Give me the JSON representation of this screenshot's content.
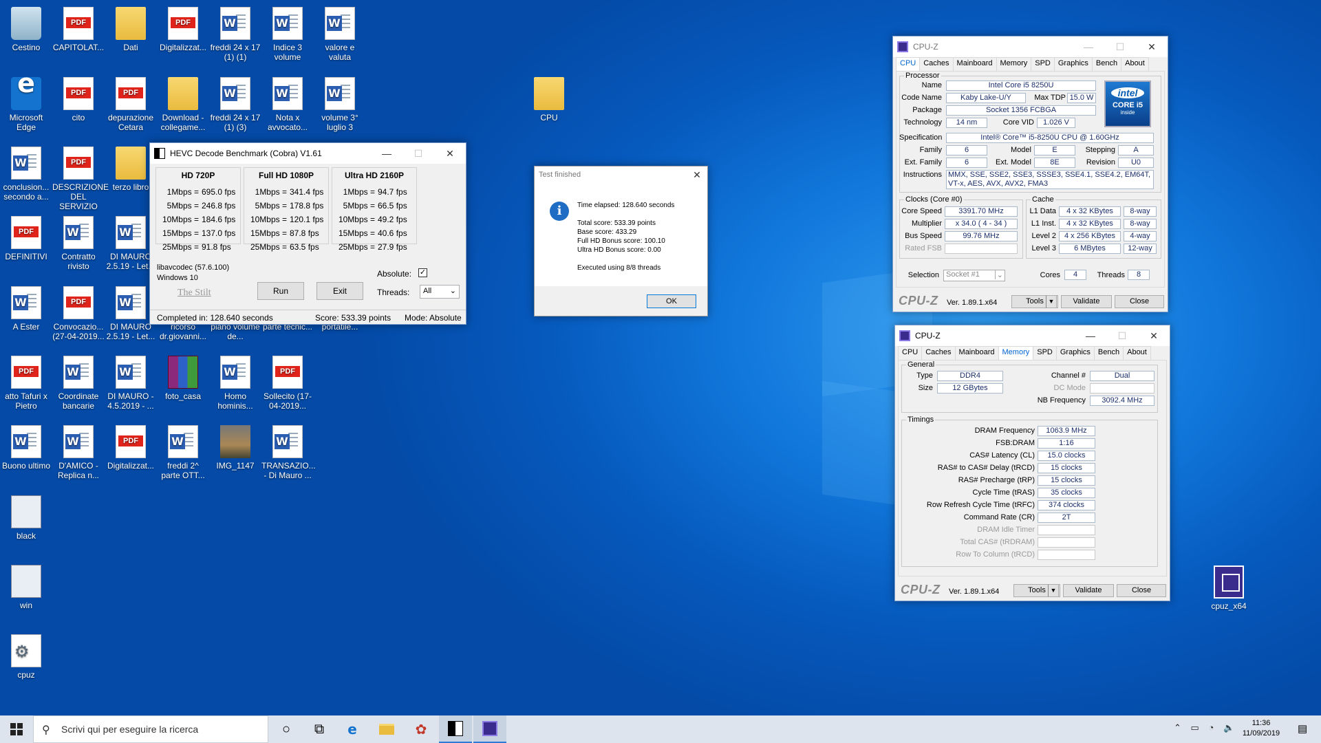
{
  "desktop_icons": [
    {
      "label": "Cestino",
      "type": "bin"
    },
    {
      "label": "CAPITOLAT...",
      "type": "pdf"
    },
    {
      "label": "Dati",
      "type": "folder"
    },
    {
      "label": "Digitalizzat...",
      "type": "pdf"
    },
    {
      "label": "freddi 24 x 17 (1) (1)",
      "type": "doc"
    },
    {
      "label": "Indice 3 volume",
      "type": "doc"
    },
    {
      "label": "valore e valuta",
      "type": "doc"
    },
    {
      "label": "Microsoft Edge",
      "type": "edge"
    },
    {
      "label": "cito",
      "type": "pdf"
    },
    {
      "label": "depurazione Cetara",
      "type": "pdf"
    },
    {
      "label": "Download - collegame...",
      "type": "folder"
    },
    {
      "label": "freddi 24 x 17 (1) (3)",
      "type": "doc"
    },
    {
      "label": "Nota x avvocato...",
      "type": "doc"
    },
    {
      "label": "volume 3° luglio 3",
      "type": "doc"
    },
    {
      "label": "conclusion... secondo a...",
      "type": "doc"
    },
    {
      "label": "DESCRIZIONE DEL SERVIZIO",
      "type": "pdf"
    },
    {
      "label": "terzo libro",
      "type": "folder"
    },
    {
      "label": "DEFINITIVI",
      "type": "pdf"
    },
    {
      "label": "Contratto rivisto",
      "type": "doc"
    },
    {
      "label": "DI MAURO 2.5.19 - Let...",
      "type": "doc"
    },
    {
      "label": "A Ester",
      "type": "doc"
    },
    {
      "label": "Convocazio... (27-04-2019...",
      "type": "pdf"
    },
    {
      "label": "DI MAURO 2.5.19 - Let...",
      "type": "doc"
    },
    {
      "label": "ricorso dr.giovanni...",
      "type": "doc"
    },
    {
      "label": "piano volume de...",
      "type": "doc"
    },
    {
      "label": "parte tecnic...",
      "type": "doc"
    },
    {
      "label": "portatile...",
      "type": "doc"
    },
    {
      "label": "atto Tafuri x Pietro",
      "type": "pdf"
    },
    {
      "label": "Coordinate bancarie",
      "type": "doc"
    },
    {
      "label": "DI MAURO - 4.5.2019 - ...",
      "type": "doc"
    },
    {
      "label": "foto_casa",
      "type": "rar"
    },
    {
      "label": "Homo hominis...",
      "type": "doc"
    },
    {
      "label": "Sollecito (17-04-2019...",
      "type": "pdf"
    },
    {
      "label": "Buono ultimo",
      "type": "doc"
    },
    {
      "label": "D'AMICO - Replica n...",
      "type": "doc"
    },
    {
      "label": "Digitalizzat...",
      "type": "pdf"
    },
    {
      "label": "freddi 2^ parte OTT...",
      "type": "doc"
    },
    {
      "label": "IMG_1147",
      "type": "photo"
    },
    {
      "label": "TRANSAZIO... - Di Mauro ...",
      "type": "doc"
    },
    {
      "label": "black",
      "type": "exe"
    },
    {
      "label": "win",
      "type": "exe"
    },
    {
      "label": "cpuz",
      "type": "gear"
    },
    {
      "label": "CPU",
      "type": "folder"
    },
    {
      "label": "cpuz_x64",
      "type": "cpuz"
    }
  ],
  "hevc": {
    "title": "HEVC Decode Benchmark (Cobra) V1.61",
    "columns": [
      {
        "heading": "HD 720P",
        "rows": [
          [
            "1Mbps =",
            "695.0 fps"
          ],
          [
            "5Mbps =",
            "246.8 fps"
          ],
          [
            "10Mbps =",
            "184.6 fps"
          ],
          [
            "15Mbps =",
            "137.0 fps"
          ],
          [
            "25Mbps =",
            "91.8 fps"
          ]
        ]
      },
      {
        "heading": "Full HD 1080P",
        "rows": [
          [
            "1Mbps =",
            "341.4 fps"
          ],
          [
            "5Mbps =",
            "178.8 fps"
          ],
          [
            "10Mbps =",
            "120.1 fps"
          ],
          [
            "15Mbps =",
            "87.8 fps"
          ],
          [
            "25Mbps =",
            "63.5 fps"
          ]
        ]
      },
      {
        "heading": "Ultra HD 2160P",
        "rows": [
          [
            "1Mbps =",
            "94.7 fps"
          ],
          [
            "5Mbps =",
            "66.5 fps"
          ],
          [
            "10Mbps =",
            "49.2 fps"
          ],
          [
            "15Mbps =",
            "40.6 fps"
          ],
          [
            "25Mbps =",
            "27.9 fps"
          ]
        ]
      }
    ],
    "libavcodec": "libavcodec (57.6.100)",
    "os": "Windows 10",
    "credit": "The Stilt",
    "run_label": "Run",
    "exit_label": "Exit",
    "absolute_label": "Absolute:",
    "threads_label": "Threads:",
    "threads_value": "All",
    "status_completed": "Completed in: 128.640 seconds",
    "status_score": "Score: 533.39 points",
    "status_mode": "Mode: Absolute"
  },
  "dialog": {
    "title": "Test finished",
    "lines": [
      "Time elapsed:  128.640 seconds",
      "",
      "Total score:  533.39 points",
      "Base score: 433.29",
      "Full HD Bonus score: 100.10",
      "Ultra HD Bonus score: 0.00",
      "",
      "Executed using 8/8 threads"
    ],
    "ok_label": "OK"
  },
  "cpuz_tabs": [
    "CPU",
    "Caches",
    "Mainboard",
    "Memory",
    "SPD",
    "Graphics",
    "Bench",
    "About"
  ],
  "cpuz1": {
    "title": "CPU-Z",
    "processor_group": "Processor",
    "name_label": "Name",
    "name": "Intel Core i5 8250U",
    "codename_label": "Code Name",
    "codename": "Kaby Lake-U/Y",
    "maxtdp_label": "Max TDP",
    "maxtdp": "15.0 W",
    "package_label": "Package",
    "package": "Socket 1356 FCBGA",
    "technology_label": "Technology",
    "technology": "14 nm",
    "corevid_label": "Core VID",
    "corevid": "1.026 V",
    "spec_label": "Specification",
    "spec": "Intel® Core™ i5-8250U CPU @ 1.60GHz",
    "family_label": "Family",
    "family": "6",
    "model_label": "Model",
    "model": "E",
    "stepping_label": "Stepping",
    "stepping": "A",
    "extfamily_label": "Ext. Family",
    "extfamily": "6",
    "extmodel_label": "Ext. Model",
    "extmodel": "8E",
    "revision_label": "Revision",
    "revision": "U0",
    "instructions_label": "Instructions",
    "instructions": "MMX, SSE, SSE2, SSE3, SSSE3, SSE4.1, SSE4.2, EM64T, VT-x, AES, AVX, AVX2, FMA3",
    "clocks_group": "Clocks (Core #0)",
    "corespeed_label": "Core Speed",
    "corespeed": "3391.70 MHz",
    "multiplier_label": "Multiplier",
    "multiplier": "x 34.0 ( 4 - 34 )",
    "busspeed_label": "Bus Speed",
    "busspeed": "99.76 MHz",
    "ratedfsb_label": "Rated FSB",
    "cache_group": "Cache",
    "caches": [
      [
        "L1 Data",
        "4 x 32 KBytes",
        "8-way"
      ],
      [
        "L1 Inst.",
        "4 x 32 KBytes",
        "8-way"
      ],
      [
        "Level 2",
        "4 x 256 KBytes",
        "4-way"
      ],
      [
        "Level 3",
        "6 MBytes",
        "12-way"
      ]
    ],
    "selection_label": "Selection",
    "selection": "Socket #1",
    "cores_label": "Cores",
    "cores": "4",
    "threads_label": "Threads",
    "threads": "8",
    "intel_badge_top": "intel",
    "intel_badge_mid": "CORE i5",
    "intel_badge_bot": "inside",
    "brand": "CPU-Z",
    "version": "Ver. 1.89.1.x64",
    "tools_label": "Tools",
    "validate_label": "Validate",
    "close_label": "Close"
  },
  "cpuz2": {
    "title": "CPU-Z",
    "general_group": "General",
    "type_label": "Type",
    "type": "DDR4",
    "channel_label": "Channel #",
    "channel": "Dual",
    "size_label": "Size",
    "size": "12 GBytes",
    "dcmode_label": "DC Mode",
    "nbfreq_label": "NB Frequency",
    "nbfreq": "3092.4 MHz",
    "timings_group": "Timings",
    "timings": [
      [
        "DRAM Frequency",
        "1063.9 MHz"
      ],
      [
        "FSB:DRAM",
        "1:16"
      ],
      [
        "CAS# Latency (CL)",
        "15.0 clocks"
      ],
      [
        "RAS# to CAS# Delay (tRCD)",
        "15 clocks"
      ],
      [
        "RAS# Precharge (tRP)",
        "15 clocks"
      ],
      [
        "Cycle Time (tRAS)",
        "35 clocks"
      ],
      [
        "Row Refresh Cycle Time (tRFC)",
        "374 clocks"
      ],
      [
        "Command Rate (CR)",
        "2T"
      ]
    ],
    "timings_disabled": [
      "DRAM Idle Timer",
      "Total CAS# (tRDRAM)",
      "Row To Column (tRCD)"
    ],
    "brand": "CPU-Z",
    "version": "Ver. 1.89.1.x64",
    "tools_label": "Tools",
    "validate_label": "Validate",
    "close_label": "Close"
  },
  "taskbar": {
    "search_placeholder": "Scrivi qui per eseguire la ricerca",
    "time": "11:36",
    "date": "11/09/2019"
  }
}
